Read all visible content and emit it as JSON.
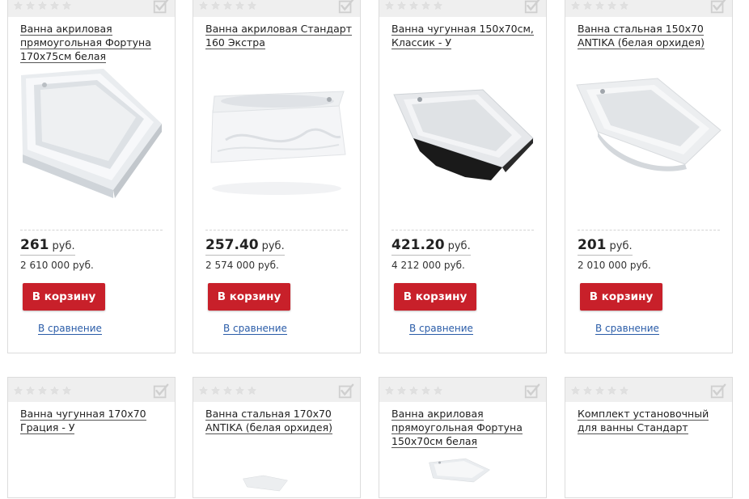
{
  "products": [
    {
      "title": "Ванна акриловая прямоугольная Фортуна 170х75см белая",
      "price": "261",
      "currency": "руб.",
      "old_price": "2 610 000 руб.",
      "cart_label": "В корзину",
      "compare_label": "В сравнение",
      "rating": 0
    },
    {
      "title": "Ванна акриловая Стандарт 160 Экстра",
      "price": "257.40",
      "currency": "руб.",
      "old_price": "2 574 000 руб.",
      "cart_label": "В корзину",
      "compare_label": "В сравнение",
      "rating": 0
    },
    {
      "title": "Ванна чугунная 150х70см, Классик - У",
      "price": "421.20",
      "currency": "руб.",
      "old_price": "4 212 000 руб.",
      "cart_label": "В корзину",
      "compare_label": "В сравнение",
      "rating": 0
    },
    {
      "title": "Ванна стальная 150х70 ANTIKA (белая орхидея)",
      "price": "201",
      "currency": "руб.",
      "old_price": "2 010 000 руб.",
      "cart_label": "В корзину",
      "compare_label": "В сравнение",
      "rating": 0
    },
    {
      "title": "Ванна чугунная 170х70 Грация - У",
      "rating": 0
    },
    {
      "title": "Ванна стальная 170х70 ANTIKA (белая орхидея)",
      "rating": 0
    },
    {
      "title": "Ванна акриловая прямоугольная Фортуна 150х70см белая",
      "rating": 0
    },
    {
      "title": "Комплект установочный для ванны Стандарт",
      "rating": 0
    }
  ],
  "colors": {
    "cart_button": "#c8202a",
    "link": "#2a5ca8",
    "star_empty": "#e4e4e4",
    "header_bg": "#efefef"
  }
}
